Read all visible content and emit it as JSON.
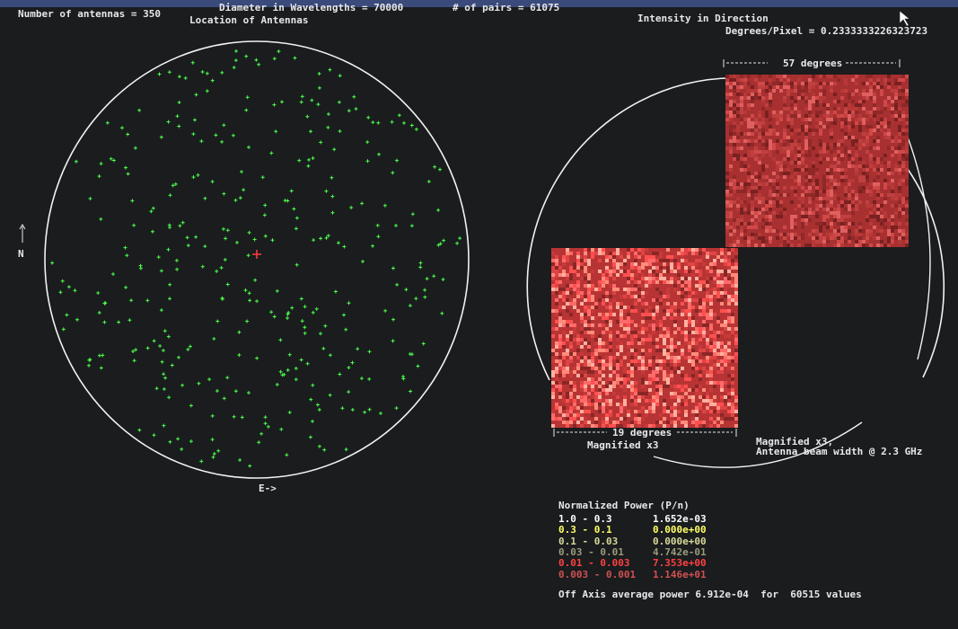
{
  "header": {
    "antennas_label": "Number of antennas = 350",
    "diameter_label": "Diameter in Wavelengths = 70000",
    "pairs_label": "# of pairs = 61075",
    "location_title": "Location of Antennas",
    "intensity_title": "Intensity in Direction",
    "degrees_pixel_label": "Degrees/Pixel = 0.2333333226323723"
  },
  "array_plot": {
    "north_label": "N",
    "east_label": "E->",
    "antenna_count": 350,
    "colors": {
      "antenna": "#4cff4c",
      "center": "#ff3c3c",
      "boundary": "#f0f0f0"
    }
  },
  "beam_plot": {
    "top_span_label": "57 degrees",
    "bottom_span_label": "19 degrees",
    "magnified_label_left": "Magnified x3",
    "magnified_label_right": "Magnified x3,",
    "beam_width_label": "Antenna beam width @ 2.3 GHz",
    "colors": {
      "image_base": "#b03030",
      "boundary": "#f0f0f0"
    }
  },
  "legend": {
    "title": "Normalized Power (P/n)",
    "rows": [
      {
        "range": "1.0 - 0.3",
        "value": "1.652e-03",
        "color": "#ffffff"
      },
      {
        "range": "0.3 - 0.1",
        "value": "0.000e+00",
        "color": "#ffff66"
      },
      {
        "range": "0.1 - 0.03",
        "value": "0.000e+00",
        "color": "#d8d89a"
      },
      {
        "range": "0.03 - 0.01",
        "value": "4.742e-01",
        "color": "#9a9a7a"
      },
      {
        "range": "0.01 - 0.003",
        "value": "7.353e+00",
        "color": "#ff4040"
      },
      {
        "range": "0.003 - 0.001",
        "value": "1.146e+01",
        "color": "#d05050"
      },
      {
        "range": "",
        "value": "",
        "color": "#6a4040"
      }
    ],
    "footer": "Off Axis average power 6.912e-04  for  60515 values"
  }
}
